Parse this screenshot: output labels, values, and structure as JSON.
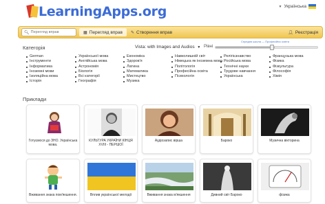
{
  "header": {
    "logo_text": "LearningApps.org",
    "language": "Українська"
  },
  "toolbar": {
    "search_placeholder": "Перегляд вправ",
    "browse_label": "Перегляд вправ",
    "create_label": "Створення вправ",
    "register_label": "Реєстрація"
  },
  "categories": {
    "title": "Категорія",
    "view_label": "Vista: with Images and Audios",
    "level_label": "Рівні",
    "level_links": "Середня школа — Професійна освіта",
    "columns": [
      [
        "German",
        "Інструменти",
        "Інформатика",
        "Іноземні мови",
        "Ізоляційна мова",
        "Історія"
      ],
      [
        "Української мова",
        "Англійська мова",
        "Астрономія",
        "Біологія",
        "Всі категорії",
        "Географія"
      ],
      [
        "Економіка",
        "Здоров'я",
        "Латина",
        "Математика",
        "Мистецтво",
        "Музика"
      ],
      [
        "Навколишній світ",
        "Німецька як іноземна мова",
        "Політологія",
        "Професійна освіта",
        "Психологія"
      ],
      [
        "Релігієзнавство",
        "Російська мова",
        "Технічні науки",
        "Трудове навчання",
        "Українська"
      ],
      [
        "Французька мова",
        "Фізика",
        "Фізкультура",
        "Філософія",
        "Хімія"
      ]
    ]
  },
  "examples": {
    "title": "Приклади",
    "row1": [
      {
        "caption": "Готуємося до ЗНО. Українська мова.",
        "icon": "girl-with-book-image"
      },
      {
        "caption": "КУЛЬТУРА УКРАЇНИ КІНЦЯ XVIII - ПЕРШОЇ",
        "icon": "historical-portrait-image"
      },
      {
        "caption": "Аудіозапис вірша",
        "icon": "woman-portrait-image"
      },
      {
        "caption": "Бароко",
        "icon": "baroque-interior-image"
      },
      {
        "caption": "Музична вікторина",
        "icon": "violin-scroll-image"
      }
    ],
    "row2": [
      {
        "caption": "Вживання знака пом'якшення.",
        "icon": "cartoon-boy-image"
      },
      {
        "caption": "Вплив української мелодії",
        "icon": "wheat-field-image"
      },
      {
        "caption": "Вживання знака м'якшення",
        "icon": "river-landscape-image"
      },
      {
        "caption": "Дивний світ Бароко",
        "icon": "baroque-sculpture-image"
      },
      {
        "caption": "фізика",
        "icon": "meter-gauge-image"
      }
    ]
  },
  "colors": {
    "toolbar": "#f0c552",
    "logo": "#3b6bd6"
  }
}
